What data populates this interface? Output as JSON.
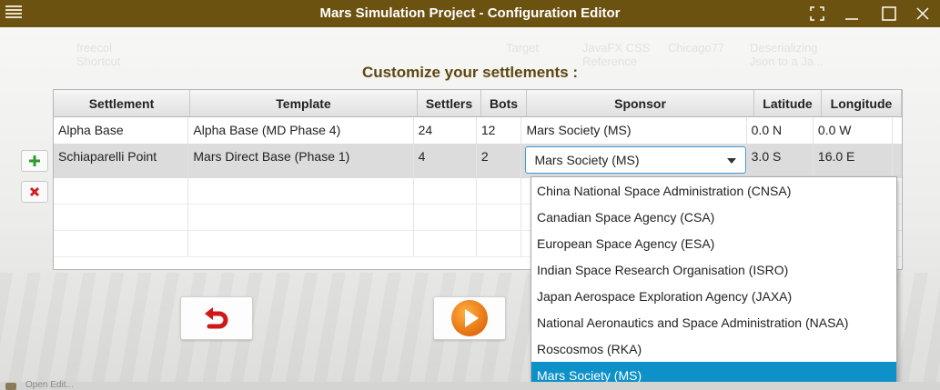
{
  "window": {
    "title": "Mars Simulation Project - Configuration Editor"
  },
  "background_ghost_text": [
    {
      "line1": "freecol",
      "line2": "Shortcut"
    },
    {
      "line1": "Target",
      "line2": ""
    },
    {
      "line1": "JavaFX CSS",
      "line2": "Reference"
    },
    {
      "line1": "Chicago77",
      "line2": ""
    },
    {
      "line1": "Deserializing",
      "line2": "Json to a Ja..."
    }
  ],
  "heading": "Customize your settlements :",
  "table": {
    "columns": [
      "Settlement",
      "Template",
      "Settlers",
      "Bots",
      "Sponsor",
      "Latitude",
      "Longitude"
    ],
    "rows": [
      {
        "settlement": "Alpha Base",
        "template": "Alpha Base (MD Phase 4)",
        "settlers": "24",
        "bots": "12",
        "sponsor": "Mars Society (MS)",
        "latitude": "0.0 N",
        "longitude": "0.0 W"
      },
      {
        "settlement": "Schiaparelli Point",
        "template": "Mars Direct Base (Phase 1)",
        "settlers": "4",
        "bots": "2",
        "sponsor": "Mars Society (MS)",
        "latitude": "3.0 S",
        "longitude": "16.0 E"
      }
    ]
  },
  "sponsor_dropdown": {
    "selected": "Mars Society (MS)",
    "options": [
      "China National Space Administration (CNSA)",
      "Canadian Space Agency (CSA)",
      "European Space Agency (ESA)",
      "Indian Space Research Organisation (ISRO)",
      "Japan Aerospace Exploration Agency (JAXA)",
      "National Aeronautics and Space Administration (NASA)",
      "Roscosmos (RKA)",
      "Mars Society (MS)"
    ]
  },
  "icons": {
    "menu": "hamburger-icon",
    "fullscreen": "fullscreen-icon",
    "minimize": "minimize-icon",
    "maximize": "maximize-icon",
    "close": "close-icon",
    "add": "plus-icon",
    "remove": "x-icon",
    "undo": "undo-arrow-icon",
    "start": "play-icon"
  },
  "colors": {
    "titlebar": "#6c5210",
    "heading": "#5d4712",
    "selection": "#0d91c8",
    "add": "#2f9a2f",
    "remove": "#d02020",
    "undo": "#d01818",
    "play": "#f07810"
  },
  "taskbar": {
    "text": "Open Edit..."
  }
}
